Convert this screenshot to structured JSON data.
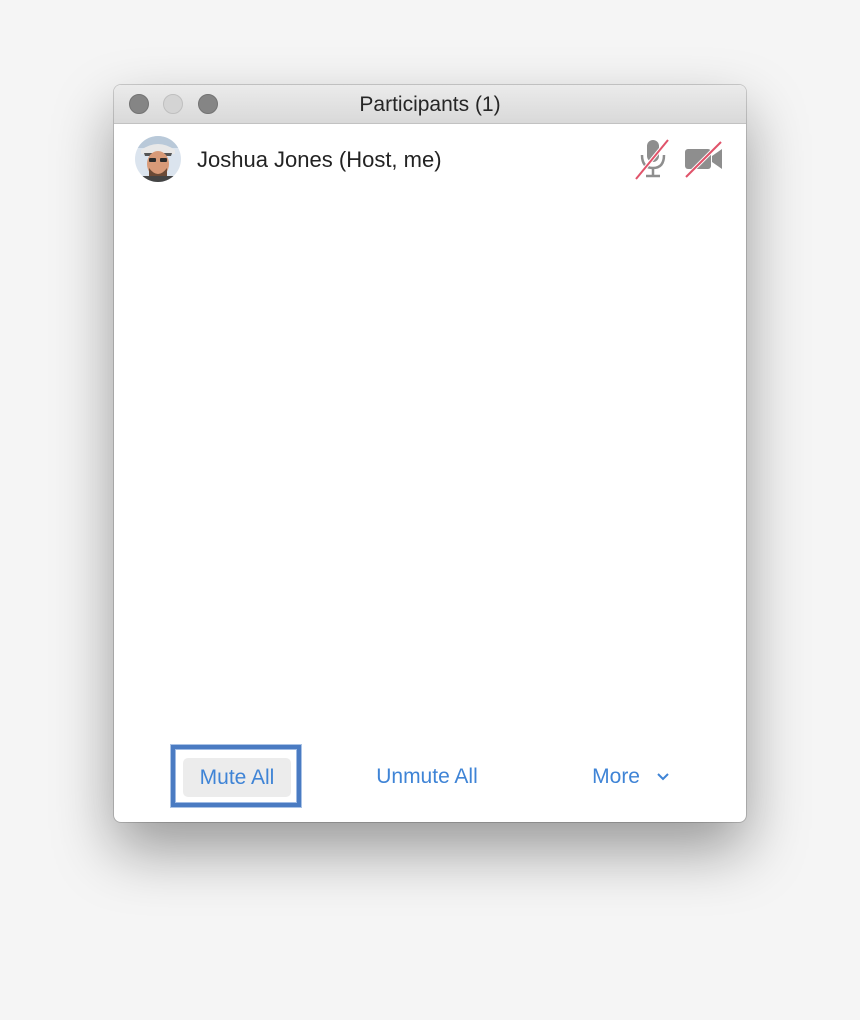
{
  "window": {
    "title": "Participants (1)"
  },
  "participants": [
    {
      "name": "Joshua Jones (Host, me)",
      "mic_icon": "microphone-muted-icon",
      "video_icon": "video-off-icon"
    }
  ],
  "footer": {
    "mute_all_label": "Mute All",
    "unmute_all_label": "Unmute All",
    "more_label": "More",
    "more_icon": "chevron-down-icon"
  },
  "colors": {
    "link_blue": "#3f84d6",
    "highlight_border": "#4a7bc2",
    "muted_slash": "#e0536a",
    "icon_gray": "#8e8e8e"
  }
}
